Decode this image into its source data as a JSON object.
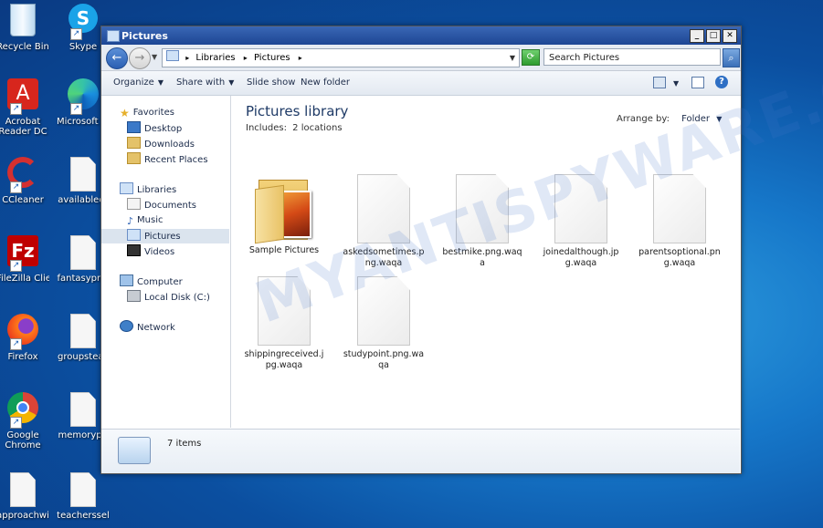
{
  "desktop": {
    "icons": [
      {
        "label": "Recycle Bin",
        "icon": "recycle-bin-icon"
      },
      {
        "label": "Skype",
        "icon": "skype-icon"
      },
      {
        "label": "Acrobat Reader DC",
        "icon": "acrobat-icon"
      },
      {
        "label": "Microsoft Ed",
        "icon": "edge-icon"
      },
      {
        "label": "CCleaner",
        "icon": "ccleaner-icon"
      },
      {
        "label": "availabledr",
        "icon": "file-icon"
      },
      {
        "label": "FileZilla Client",
        "icon": "filezilla-icon"
      },
      {
        "label": "fantasyprof",
        "icon": "file-icon"
      },
      {
        "label": "Firefox",
        "icon": "firefox-icon"
      },
      {
        "label": "groupsteac",
        "icon": "file-icon"
      },
      {
        "label": "Google Chrome",
        "icon": "chrome-icon"
      },
      {
        "label": "memorypri",
        "icon": "file-icon"
      },
      {
        "label": "approachwi",
        "icon": "file-icon"
      },
      {
        "label": "teacherssel",
        "icon": "file-icon"
      }
    ]
  },
  "window": {
    "title": "Pictures",
    "buttons": {
      "minimize": "_",
      "maximize": "□",
      "close": "✕"
    }
  },
  "address": {
    "crumbs": [
      "Libraries",
      "Pictures"
    ],
    "sep": "▸",
    "search_placeholder": "Search Pictures"
  },
  "toolbar": {
    "organize": "Organize",
    "share_with": "Share with",
    "slide_show": "Slide show",
    "new_folder": "New folder",
    "help": "?"
  },
  "nav": {
    "favorites": "Favorites",
    "desktop": "Desktop",
    "downloads": "Downloads",
    "recent": "Recent Places",
    "libraries": "Libraries",
    "documents": "Documents",
    "music": "Music",
    "pictures": "Pictures",
    "videos": "Videos",
    "computer": "Computer",
    "local_disk": "Local Disk (C:)",
    "network": "Network"
  },
  "content": {
    "title": "Pictures library",
    "includes_label": "Includes:",
    "includes_value": "2 locations",
    "arrange_label": "Arrange by:",
    "arrange_value": "Folder",
    "items": [
      {
        "name": "Sample Pictures",
        "type": "folder"
      },
      {
        "name": "askedsometimes.png.waqa",
        "type": "file"
      },
      {
        "name": "bestmike.png.waqa",
        "type": "file"
      },
      {
        "name": "joinedalthough.jpg.waqa",
        "type": "file"
      },
      {
        "name": "parentsoptional.png.waqa",
        "type": "file"
      },
      {
        "name": "shippingreceived.jpg.waqa",
        "type": "file"
      },
      {
        "name": "studypoint.png.waqa",
        "type": "file"
      }
    ]
  },
  "details": {
    "count": "7 items"
  },
  "watermark": "MYANTISPYWARE.COM"
}
